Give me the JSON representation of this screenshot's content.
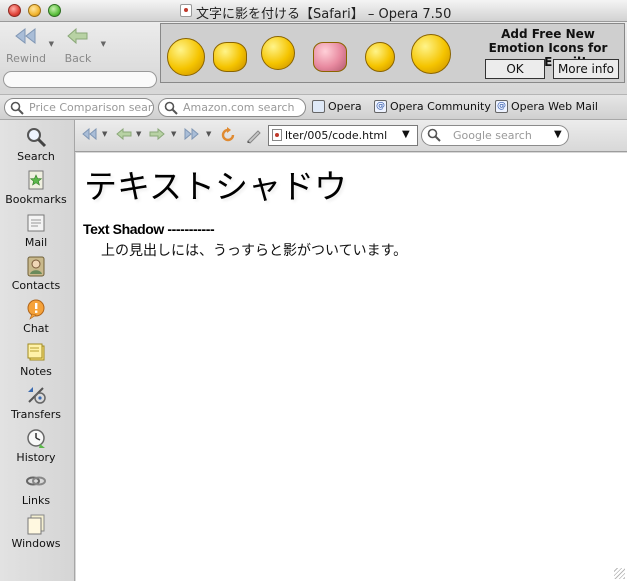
{
  "window": {
    "title": "文字に影を付ける【Safari】 – Opera 7.50"
  },
  "toolbar": {
    "rewind_label": "Rewind",
    "back_label": "Back"
  },
  "ad_banner": {
    "headline": "Add Free New Emotion Icons for your Email!",
    "ok_label": "OK",
    "more_info_label": "More info"
  },
  "personal_bar": {
    "search_price": {
      "placeholder": "Price Comparison sear"
    },
    "search_amazon": {
      "placeholder": "Amazon.com search"
    },
    "bookmarks": [
      {
        "label": "Opera",
        "icon": "page-icon"
      },
      {
        "label": "Opera Community",
        "icon": "at-icon"
      },
      {
        "label": "Opera Web Mail",
        "icon": "at-icon"
      }
    ]
  },
  "address_bar": {
    "url": "lter/005/code.html",
    "google": {
      "placeholder": "Google search"
    }
  },
  "sidebar": {
    "items": [
      {
        "label": "Search",
        "icon": "search-icon"
      },
      {
        "label": "Bookmarks",
        "icon": "bookmarks-icon"
      },
      {
        "label": "Mail",
        "icon": "mail-icon"
      },
      {
        "label": "Contacts",
        "icon": "contacts-icon"
      },
      {
        "label": "Chat",
        "icon": "chat-icon"
      },
      {
        "label": "Notes",
        "icon": "notes-icon"
      },
      {
        "label": "Transfers",
        "icon": "transfers-icon"
      },
      {
        "label": "History",
        "icon": "history-icon"
      },
      {
        "label": "Links",
        "icon": "links-icon"
      },
      {
        "label": "Windows",
        "icon": "windows-icon"
      }
    ]
  },
  "page": {
    "heading": "テキストシャドウ",
    "subheading": "Text Shadow -----------",
    "body": "上の見出しには、うっすらと影がついています。"
  }
}
